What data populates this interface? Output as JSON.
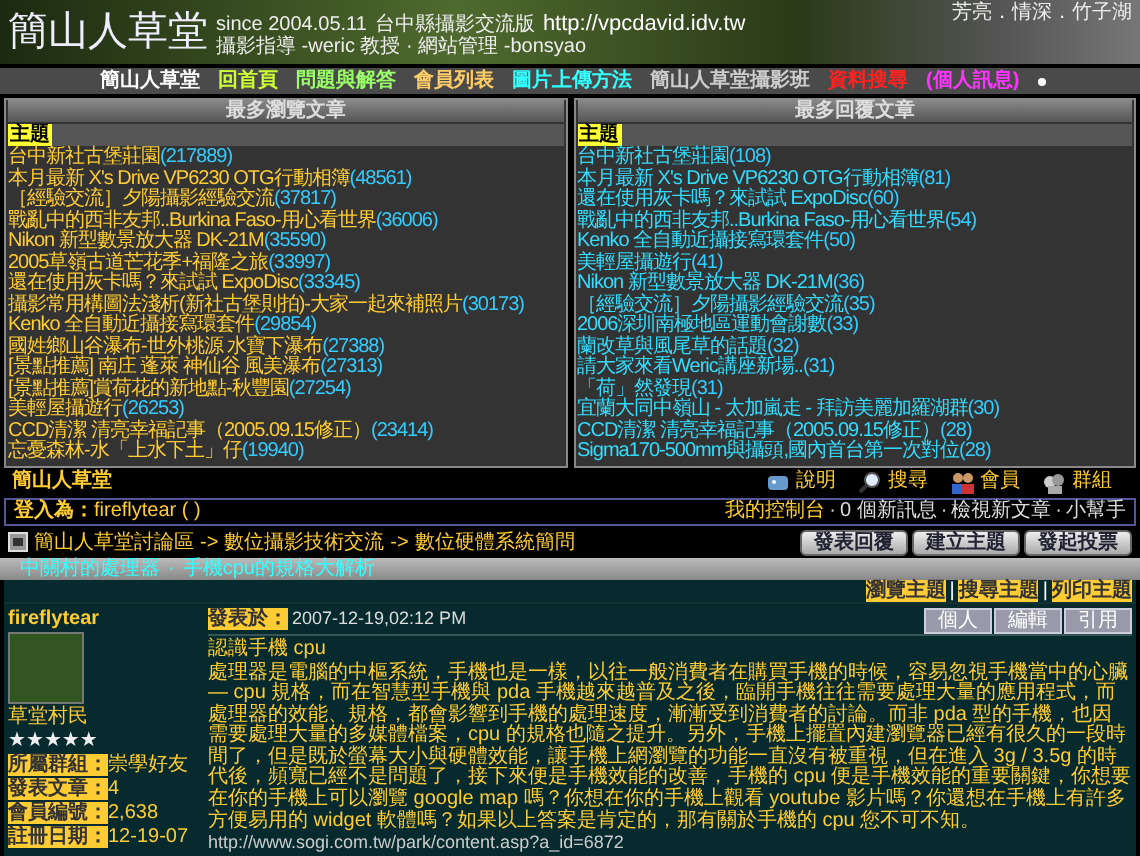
{
  "banner": {
    "title": "簡山人草堂",
    "since": "since 2004.05.11",
    "subtitle": "台中縣攝影交流版",
    "url": "http://vpcdavid.idv.tw",
    "staff": "攝影指導 -weric 教授 · 網站管理 -bonsyao",
    "motto": "芳亮．情深．竹子湖"
  },
  "nav": [
    {
      "label": "簡山人草堂",
      "color": "#ffffff"
    },
    {
      "label": "回首頁",
      "color": "#ccff33"
    },
    {
      "label": "問題與解答",
      "color": "#99ff66"
    },
    {
      "label": "會員列表",
      "color": "#ffcc66"
    },
    {
      "label": "圖片上傳方法",
      "color": "#33ffff"
    },
    {
      "label": "簡山人草堂攝影班",
      "color": "#cccccc"
    },
    {
      "label": "資料搜尋",
      "color": "#ff2222"
    },
    {
      "label": "(個人訊息)",
      "color": "#ff33ff"
    }
  ],
  "panels": [
    {
      "title": "最多瀏覽文章",
      "column": "主題",
      "rows": [
        {
          "topic": "台中新社古堡莊園",
          "count": "(217889)"
        },
        {
          "topic": "本月最新 X's Drive VP6230 OTG行動相簿",
          "count": "(48561)"
        },
        {
          "topic": "［經驗交流］夕陽攝影經驗交流",
          "count": "(37817)"
        },
        {
          "topic": "戰亂中的西非友邦..Burkina Faso-用心看世界",
          "count": "(36006)"
        },
        {
          "topic": "Nikon 新型數景放大器 DK-21M",
          "count": "(35590)"
        },
        {
          "topic": "2005草嶺古道芒花季+福隆之旅",
          "count": "(33997)"
        },
        {
          "topic": "還在使用灰卡嗎？來試試 ExpoDisc",
          "count": "(33345)"
        },
        {
          "topic": "攝影常用構圖法淺析(新社古堡則拍)-大家一起來補照片",
          "count": "(30173)"
        },
        {
          "topic": "Kenko 全自動近攝接寫環套件",
          "count": "(29854)"
        },
        {
          "topic": "國姓鄉山谷瀑布-世外桃源 水寶下瀑布",
          "count": "(27388)"
        },
        {
          "topic": "[景點推薦] 南庄 蓬萊 神仙谷 風美瀑布",
          "count": "(27313)"
        },
        {
          "topic": "[景點推薦]賞荷花的新地點-秋豐園",
          "count": "(27254)"
        },
        {
          "topic": "美輕屋攝遊行",
          "count": "(26253)"
        },
        {
          "topic": "CCD清潔 清亮幸福記事（2005.09.15修正）",
          "count": "(23414)"
        },
        {
          "topic": "忘憂森林-水「上水下土」仔",
          "count": "(19940)"
        }
      ]
    },
    {
      "title": "最多回覆文章",
      "column": "主題",
      "rows": [
        {
          "topic": "台中新社古堡莊園",
          "count": "(108)"
        },
        {
          "topic": "本月最新 X's Drive VP6230 OTG行動相簿",
          "count": "(81)"
        },
        {
          "topic": "還在使用灰卡嗎？來試試 ExpoDisc",
          "count": "(60)"
        },
        {
          "topic": "戰亂中的西非友邦..Burkina Faso-用心看世界",
          "count": "(54)"
        },
        {
          "topic": "Kenko 全自動近攝接寫環套件",
          "count": "(50)"
        },
        {
          "topic": "美輕屋攝遊行",
          "count": "(41)"
        },
        {
          "topic": "Nikon 新型數景放大器 DK-21M",
          "count": "(36)"
        },
        {
          "topic": "［經驗交流］夕陽攝影經驗交流",
          "count": "(35)"
        },
        {
          "topic": "2006深圳南極地區運動會謝數",
          "count": "(33)"
        },
        {
          "topic": "蘭改草與風尾草的話題",
          "count": "(32)"
        },
        {
          "topic": "請大家來看Weric講座新場..",
          "count": "(31)"
        },
        {
          "topic": "「荷」然發現",
          "count": "(31)"
        },
        {
          "topic": "宜蘭大同中嶺山 - 太加嵐走 - 拜訪美麗加羅湖群",
          "count": "(30)"
        },
        {
          "topic": "CCD清潔 清亮幸福記事（2005.09.15修正）",
          "count": "(28)"
        },
        {
          "topic": "Sigma170-500mm與攝頭,國內首台第一次對位",
          "count": "(28)"
        }
      ]
    }
  ],
  "site_label": "簡山人草堂",
  "tools": [
    "說明",
    "搜尋",
    "會員",
    "群組"
  ],
  "login": {
    "label": "登入為：",
    "user": "fireflytear ( )",
    "links": [
      "我的控制台",
      "0 個新訊息",
      "檢視新文章",
      "小幫手"
    ],
    "separator": "·"
  },
  "breadcrumb": [
    "簡山人草堂討論區",
    "數位攝影技術交流",
    "數位硬體系統簡問"
  ],
  "breadcrumb_separator": "->",
  "actions": [
    "發表回覆",
    "建立主題",
    "發起投票"
  ],
  "topic_bar": {
    "links": [
      "中關村的處理器",
      "手機cpu的規格大解析"
    ],
    "separator": "·"
  },
  "topic_links": {
    "links": [
      "瀏覽主題",
      "搜尋主題",
      "列印主題"
    ],
    "separator": "|"
  },
  "post": {
    "author": "fireflytear",
    "rank": "草堂村民",
    "stars": 5,
    "meta": [
      {
        "label": "所屬群組：",
        "value": "崇學好友"
      },
      {
        "label": "發表文章：",
        "value": "4"
      },
      {
        "label": "會員編號：",
        "value": "2,638"
      },
      {
        "label": "註冊日期：",
        "value": "12-19-07"
      }
    ],
    "posted_label": "發表於：",
    "posted": "2007-12-19,02:12 PM",
    "buttons": [
      "個人",
      "編輯",
      "引用"
    ],
    "title": "認識手機 cpu",
    "body": "處理器是電腦的中樞系統，手機也是一樣，以往一般消費者在購買手機的時候，容易忽視手機當中的心臟 — cpu 規格，而在智慧型手機與 pda 手機越來越普及之後，臨開手機往往需要處理大量的應用程式，而處理器的效能、規格，都會影響到手機的處理速度，漸漸受到消費者的討論。而非 pda 型的手機，也因需要處理大量的多媒體檔案，cpu 的規格也隨之提升。另外，手機上擺置內建瀏覽器已經有很久的一段時間了，但是既於螢幕大小與硬體效能，讓手機上網瀏覽的功能一直沒有被重視，但在進入 3g / 3.5g 的時代後，頻寬已經不是問題了，接下來便是手機效能的改善，手機的 cpu 便是手機效能的重要關鍵，你想要在你的手機上可以瀏覽 google map 嗎？你想在你的手機上觀看 youtube 影片嗎？你還想在手機上有許多方便易用的 widget 軟體嗎？如果以上答案是肯定的，那有關於手機的 cpu 您不可不知。",
    "link": "http://www.sogi.com.tw/park/content.asp?a_id=6872"
  }
}
